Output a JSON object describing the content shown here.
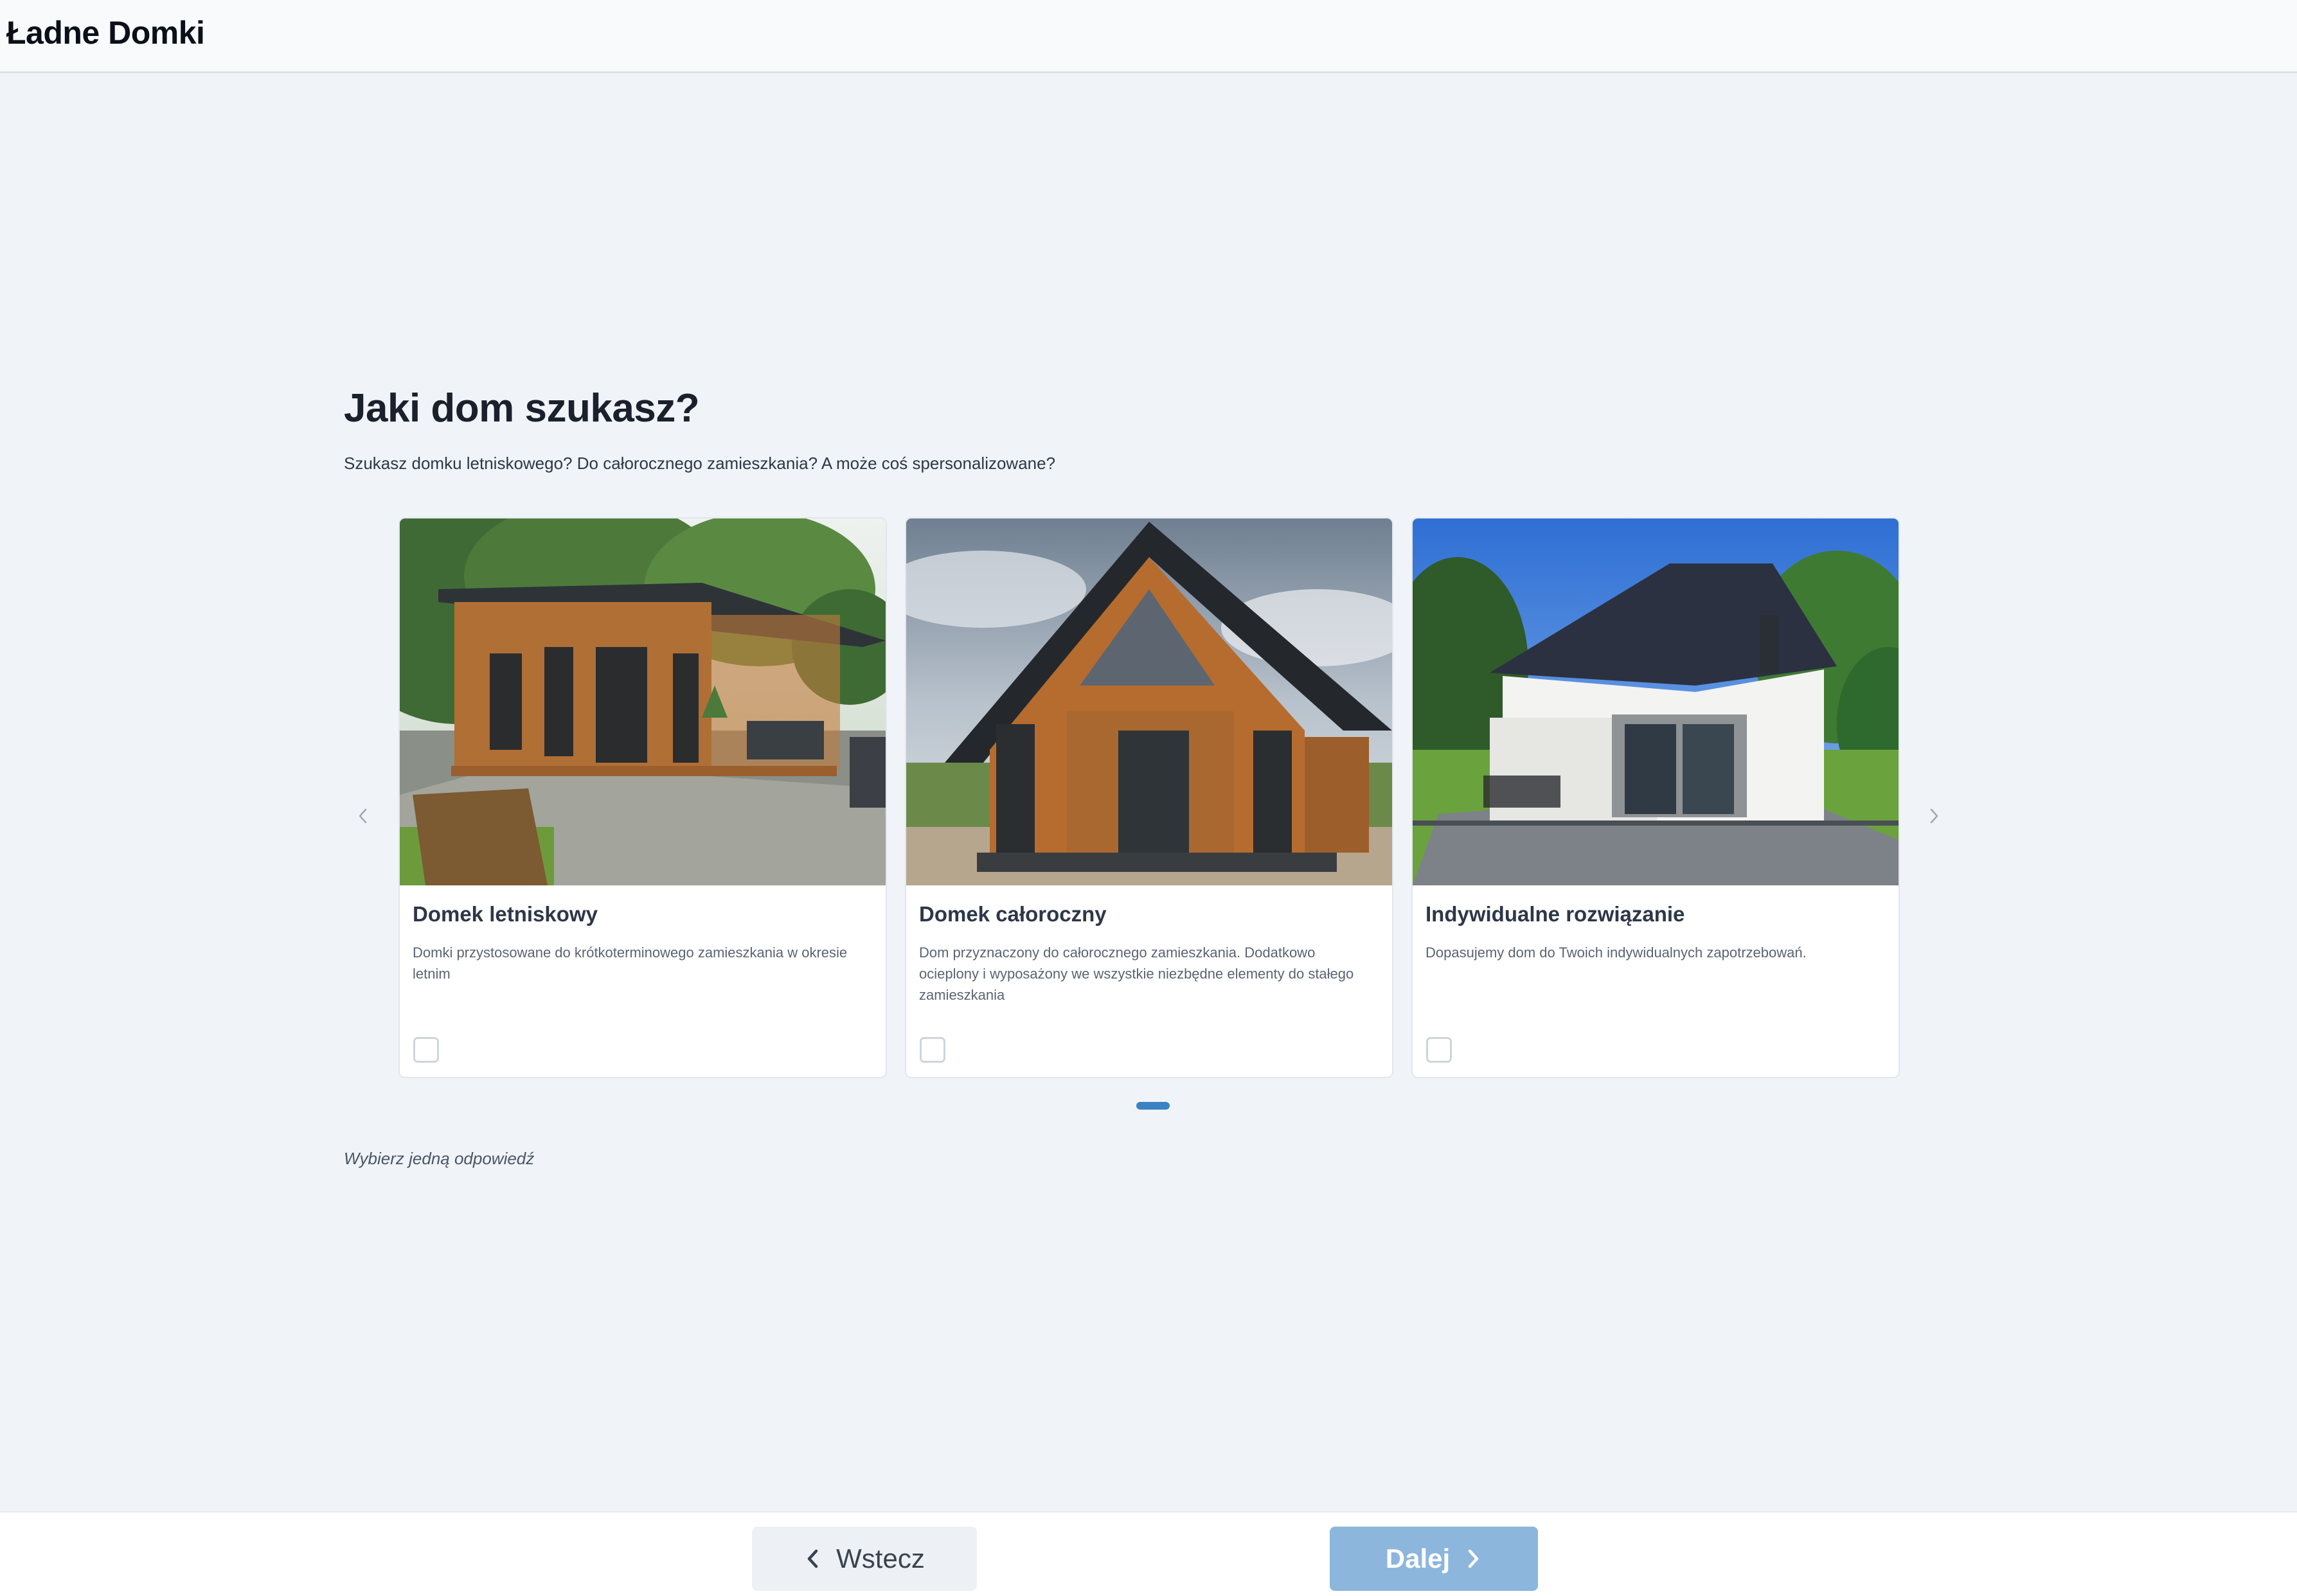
{
  "header": {
    "brand": "Ładne Domki"
  },
  "question": {
    "title": "Jaki dom szukasz?",
    "subtitle": "Szukasz domku letniskowego? Do całorocznego zamieszkania? A może coś spersonalizowane?",
    "hint": "Wybierz jedną odpowiedź"
  },
  "carousel": {
    "prev_icon": "chevron-left-icon",
    "next_icon": "chevron-right-icon",
    "active_page": 1,
    "cards": [
      {
        "title": "Domek letniskowy",
        "description": "Domki przystosowane do krótkoterminowego zamieszkania w okresie letnim",
        "checked": false
      },
      {
        "title": "Domek całoroczny",
        "description": "Dom przyznaczony do całorocznego zamieszkania. Dodatkowo ocieplony i wyposażony we wszystkie niezbędne elementy do stałego zamieszkania",
        "checked": false
      },
      {
        "title": "Indywidualne rozwiązanie",
        "description": "Dopasujemy dom do Twoich indywidualnych zapotrzebowań.",
        "checked": false
      }
    ]
  },
  "footer": {
    "back_label": "Wstecz",
    "next_label": "Dalej"
  },
  "colors": {
    "page_bg": "#f0f4f8",
    "next_button": "#8db6dd",
    "back_button": "#edf1f6",
    "carousel_dot": "#3b82c4"
  }
}
